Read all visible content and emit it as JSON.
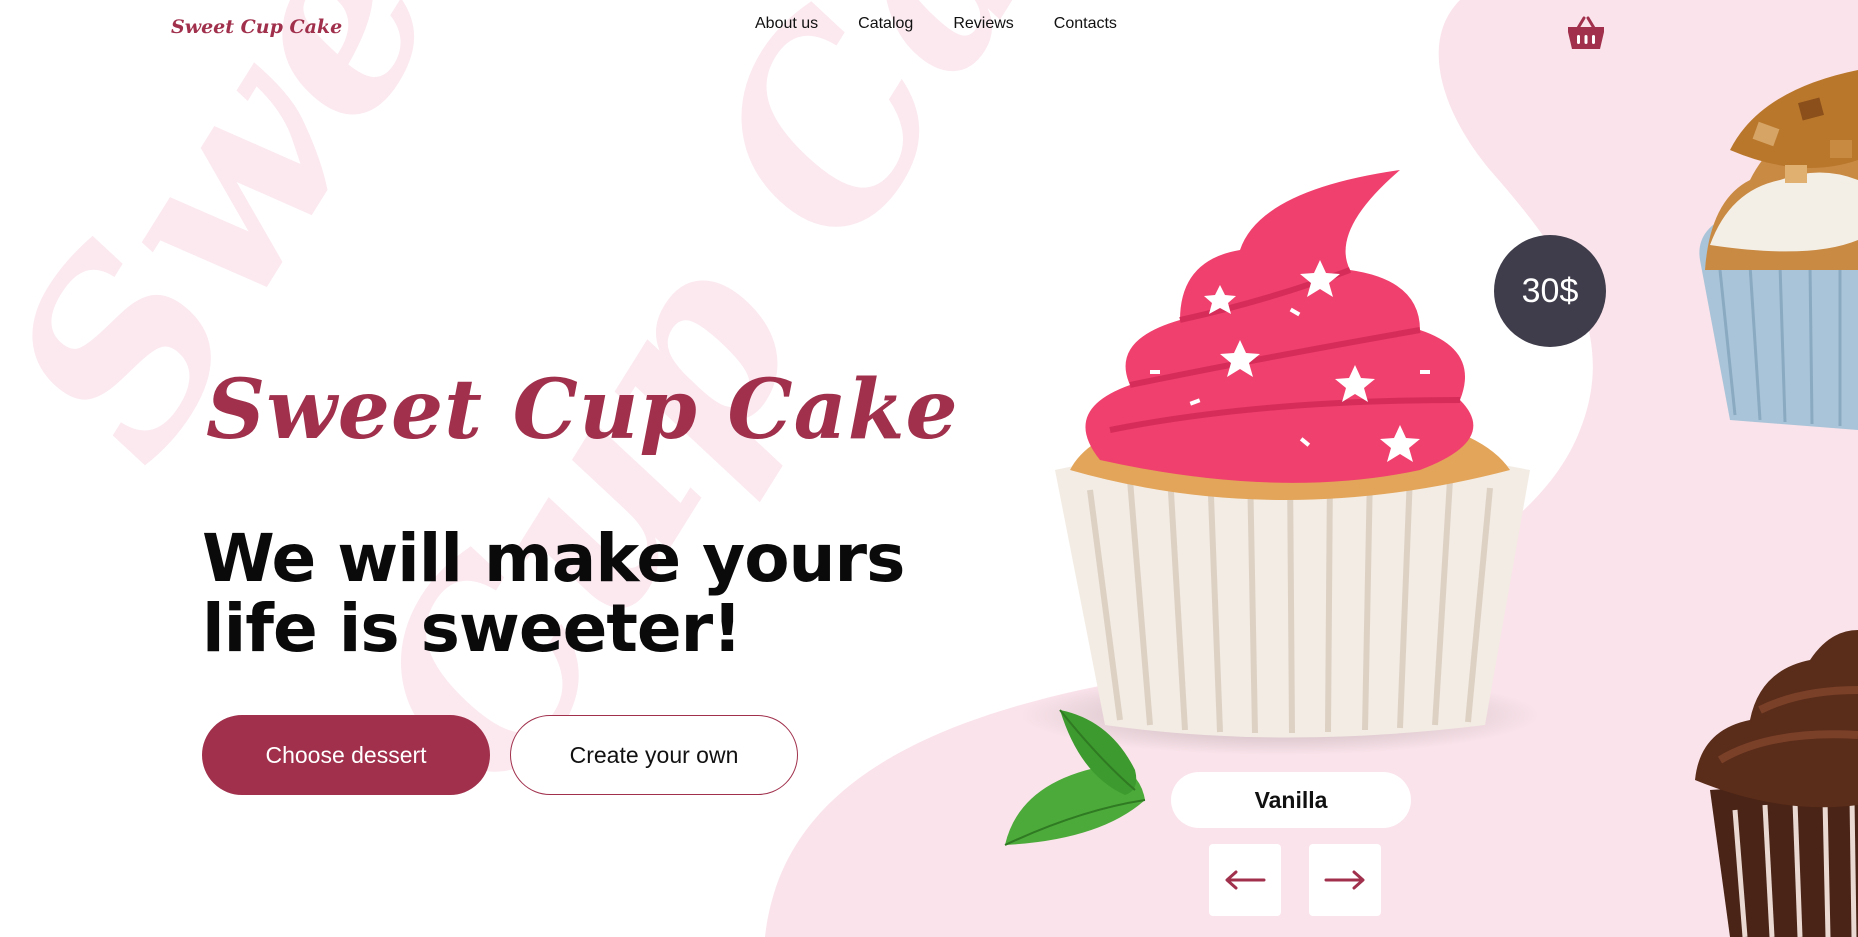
{
  "brand": {
    "logo_text": "Sweet Cup Cake"
  },
  "nav": {
    "items": [
      {
        "label": "About us"
      },
      {
        "label": "Catalog"
      },
      {
        "label": "Reviews"
      },
      {
        "label": "Contacts"
      }
    ]
  },
  "hero": {
    "title": "Sweet Cup Cake",
    "subtitle_line1": "We will make yours",
    "subtitle_line2": "life is sweeter!",
    "primary_button": "Choose dessert",
    "secondary_button": "Create your own",
    "watermark_1": "Sweet",
    "watermark_2": "Cup Cake"
  },
  "product": {
    "price": "30$",
    "flavor": "Vanilla"
  },
  "colors": {
    "brand": "#a0304c",
    "blob": "#fae3ea",
    "price_badge": "#3f3d4b",
    "frosting": "#f0406e"
  },
  "icons": {
    "basket": "basket-icon",
    "prev": "arrow-left-icon",
    "next": "arrow-right-icon"
  }
}
